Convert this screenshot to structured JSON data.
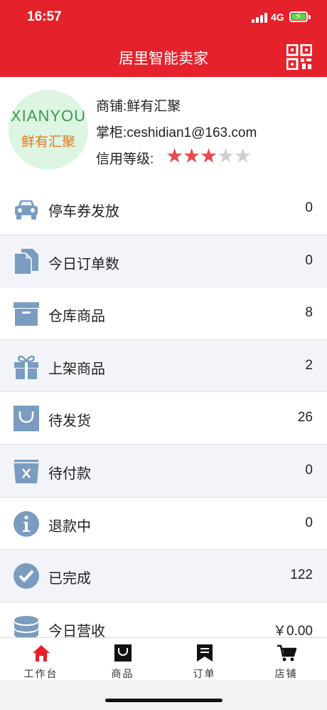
{
  "status_bar": {
    "time": "16:57",
    "network": "4G"
  },
  "header": {
    "title": "居里智能卖家",
    "qr_icon": "qr-code-icon",
    "bg_color": "#e5222c"
  },
  "profile": {
    "logo_text_top": "XIANYOU",
    "logo_text_bottom": "鲜有汇聚",
    "shop": "商铺:鲜有汇聚",
    "owner": "掌柜:ceshidian1@163.com",
    "credit_label": "信用等级:",
    "credit_stars": 3,
    "credit_max": 5,
    "star_color": "#e74b4b"
  },
  "list": [
    {
      "icon": "car-icon",
      "label": "停车券发放",
      "value": "0"
    },
    {
      "icon": "documents-icon",
      "label": "今日订单数",
      "value": "0"
    },
    {
      "icon": "archive-box-icon",
      "label": "仓库商品",
      "value": "8"
    },
    {
      "icon": "gift-icon",
      "label": "上架商品",
      "value": "2"
    },
    {
      "icon": "shopping-bag-icon",
      "label": "待发货",
      "value": "26"
    },
    {
      "icon": "trash-bin-icon",
      "label": "待付款",
      "value": "0"
    },
    {
      "icon": "info-icon",
      "label": "退款中",
      "value": "0"
    },
    {
      "icon": "checkmark-circle-icon",
      "label": "已完成",
      "value": "122"
    },
    {
      "icon": "coin-stack-icon",
      "label": "今日营收",
      "value": "￥0.00"
    }
  ],
  "tabbar": [
    {
      "icon": "home-icon",
      "label": "工作台",
      "active": true
    },
    {
      "icon": "bag-icon",
      "label": "商品",
      "active": false
    },
    {
      "icon": "order-list-icon",
      "label": "订单",
      "active": false
    },
    {
      "icon": "cart-icon",
      "label": "店铺",
      "active": false
    }
  ]
}
